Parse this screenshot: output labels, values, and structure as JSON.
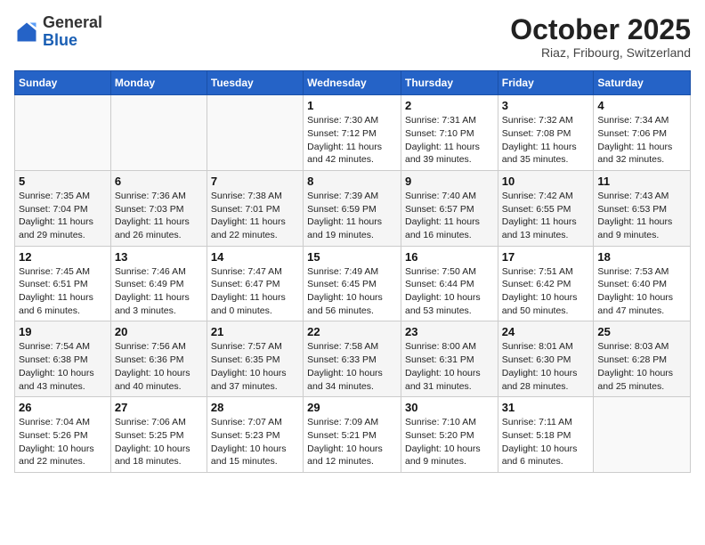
{
  "header": {
    "logo_general": "General",
    "logo_blue": "Blue",
    "month_title": "October 2025",
    "subtitle": "Riaz, Fribourg, Switzerland"
  },
  "weekdays": [
    "Sunday",
    "Monday",
    "Tuesday",
    "Wednesday",
    "Thursday",
    "Friday",
    "Saturday"
  ],
  "weeks": [
    [
      {
        "day": "",
        "sunrise": "",
        "sunset": "",
        "daylight": ""
      },
      {
        "day": "",
        "sunrise": "",
        "sunset": "",
        "daylight": ""
      },
      {
        "day": "",
        "sunrise": "",
        "sunset": "",
        "daylight": ""
      },
      {
        "day": "1",
        "sunrise": "Sunrise: 7:30 AM",
        "sunset": "Sunset: 7:12 PM",
        "daylight": "Daylight: 11 hours and 42 minutes."
      },
      {
        "day": "2",
        "sunrise": "Sunrise: 7:31 AM",
        "sunset": "Sunset: 7:10 PM",
        "daylight": "Daylight: 11 hours and 39 minutes."
      },
      {
        "day": "3",
        "sunrise": "Sunrise: 7:32 AM",
        "sunset": "Sunset: 7:08 PM",
        "daylight": "Daylight: 11 hours and 35 minutes."
      },
      {
        "day": "4",
        "sunrise": "Sunrise: 7:34 AM",
        "sunset": "Sunset: 7:06 PM",
        "daylight": "Daylight: 11 hours and 32 minutes."
      }
    ],
    [
      {
        "day": "5",
        "sunrise": "Sunrise: 7:35 AM",
        "sunset": "Sunset: 7:04 PM",
        "daylight": "Daylight: 11 hours and 29 minutes."
      },
      {
        "day": "6",
        "sunrise": "Sunrise: 7:36 AM",
        "sunset": "Sunset: 7:03 PM",
        "daylight": "Daylight: 11 hours and 26 minutes."
      },
      {
        "day": "7",
        "sunrise": "Sunrise: 7:38 AM",
        "sunset": "Sunset: 7:01 PM",
        "daylight": "Daylight: 11 hours and 22 minutes."
      },
      {
        "day": "8",
        "sunrise": "Sunrise: 7:39 AM",
        "sunset": "Sunset: 6:59 PM",
        "daylight": "Daylight: 11 hours and 19 minutes."
      },
      {
        "day": "9",
        "sunrise": "Sunrise: 7:40 AM",
        "sunset": "Sunset: 6:57 PM",
        "daylight": "Daylight: 11 hours and 16 minutes."
      },
      {
        "day": "10",
        "sunrise": "Sunrise: 7:42 AM",
        "sunset": "Sunset: 6:55 PM",
        "daylight": "Daylight: 11 hours and 13 minutes."
      },
      {
        "day": "11",
        "sunrise": "Sunrise: 7:43 AM",
        "sunset": "Sunset: 6:53 PM",
        "daylight": "Daylight: 11 hours and 9 minutes."
      }
    ],
    [
      {
        "day": "12",
        "sunrise": "Sunrise: 7:45 AM",
        "sunset": "Sunset: 6:51 PM",
        "daylight": "Daylight: 11 hours and 6 minutes."
      },
      {
        "day": "13",
        "sunrise": "Sunrise: 7:46 AM",
        "sunset": "Sunset: 6:49 PM",
        "daylight": "Daylight: 11 hours and 3 minutes."
      },
      {
        "day": "14",
        "sunrise": "Sunrise: 7:47 AM",
        "sunset": "Sunset: 6:47 PM",
        "daylight": "Daylight: 11 hours and 0 minutes."
      },
      {
        "day": "15",
        "sunrise": "Sunrise: 7:49 AM",
        "sunset": "Sunset: 6:45 PM",
        "daylight": "Daylight: 10 hours and 56 minutes."
      },
      {
        "day": "16",
        "sunrise": "Sunrise: 7:50 AM",
        "sunset": "Sunset: 6:44 PM",
        "daylight": "Daylight: 10 hours and 53 minutes."
      },
      {
        "day": "17",
        "sunrise": "Sunrise: 7:51 AM",
        "sunset": "Sunset: 6:42 PM",
        "daylight": "Daylight: 10 hours and 50 minutes."
      },
      {
        "day": "18",
        "sunrise": "Sunrise: 7:53 AM",
        "sunset": "Sunset: 6:40 PM",
        "daylight": "Daylight: 10 hours and 47 minutes."
      }
    ],
    [
      {
        "day": "19",
        "sunrise": "Sunrise: 7:54 AM",
        "sunset": "Sunset: 6:38 PM",
        "daylight": "Daylight: 10 hours and 43 minutes."
      },
      {
        "day": "20",
        "sunrise": "Sunrise: 7:56 AM",
        "sunset": "Sunset: 6:36 PM",
        "daylight": "Daylight: 10 hours and 40 minutes."
      },
      {
        "day": "21",
        "sunrise": "Sunrise: 7:57 AM",
        "sunset": "Sunset: 6:35 PM",
        "daylight": "Daylight: 10 hours and 37 minutes."
      },
      {
        "day": "22",
        "sunrise": "Sunrise: 7:58 AM",
        "sunset": "Sunset: 6:33 PM",
        "daylight": "Daylight: 10 hours and 34 minutes."
      },
      {
        "day": "23",
        "sunrise": "Sunrise: 8:00 AM",
        "sunset": "Sunset: 6:31 PM",
        "daylight": "Daylight: 10 hours and 31 minutes."
      },
      {
        "day": "24",
        "sunrise": "Sunrise: 8:01 AM",
        "sunset": "Sunset: 6:30 PM",
        "daylight": "Daylight: 10 hours and 28 minutes."
      },
      {
        "day": "25",
        "sunrise": "Sunrise: 8:03 AM",
        "sunset": "Sunset: 6:28 PM",
        "daylight": "Daylight: 10 hours and 25 minutes."
      }
    ],
    [
      {
        "day": "26",
        "sunrise": "Sunrise: 7:04 AM",
        "sunset": "Sunset: 5:26 PM",
        "daylight": "Daylight: 10 hours and 22 minutes."
      },
      {
        "day": "27",
        "sunrise": "Sunrise: 7:06 AM",
        "sunset": "Sunset: 5:25 PM",
        "daylight": "Daylight: 10 hours and 18 minutes."
      },
      {
        "day": "28",
        "sunrise": "Sunrise: 7:07 AM",
        "sunset": "Sunset: 5:23 PM",
        "daylight": "Daylight: 10 hours and 15 minutes."
      },
      {
        "day": "29",
        "sunrise": "Sunrise: 7:09 AM",
        "sunset": "Sunset: 5:21 PM",
        "daylight": "Daylight: 10 hours and 12 minutes."
      },
      {
        "day": "30",
        "sunrise": "Sunrise: 7:10 AM",
        "sunset": "Sunset: 5:20 PM",
        "daylight": "Daylight: 10 hours and 9 minutes."
      },
      {
        "day": "31",
        "sunrise": "Sunrise: 7:11 AM",
        "sunset": "Sunset: 5:18 PM",
        "daylight": "Daylight: 10 hours and 6 minutes."
      },
      {
        "day": "",
        "sunrise": "",
        "sunset": "",
        "daylight": ""
      }
    ]
  ]
}
